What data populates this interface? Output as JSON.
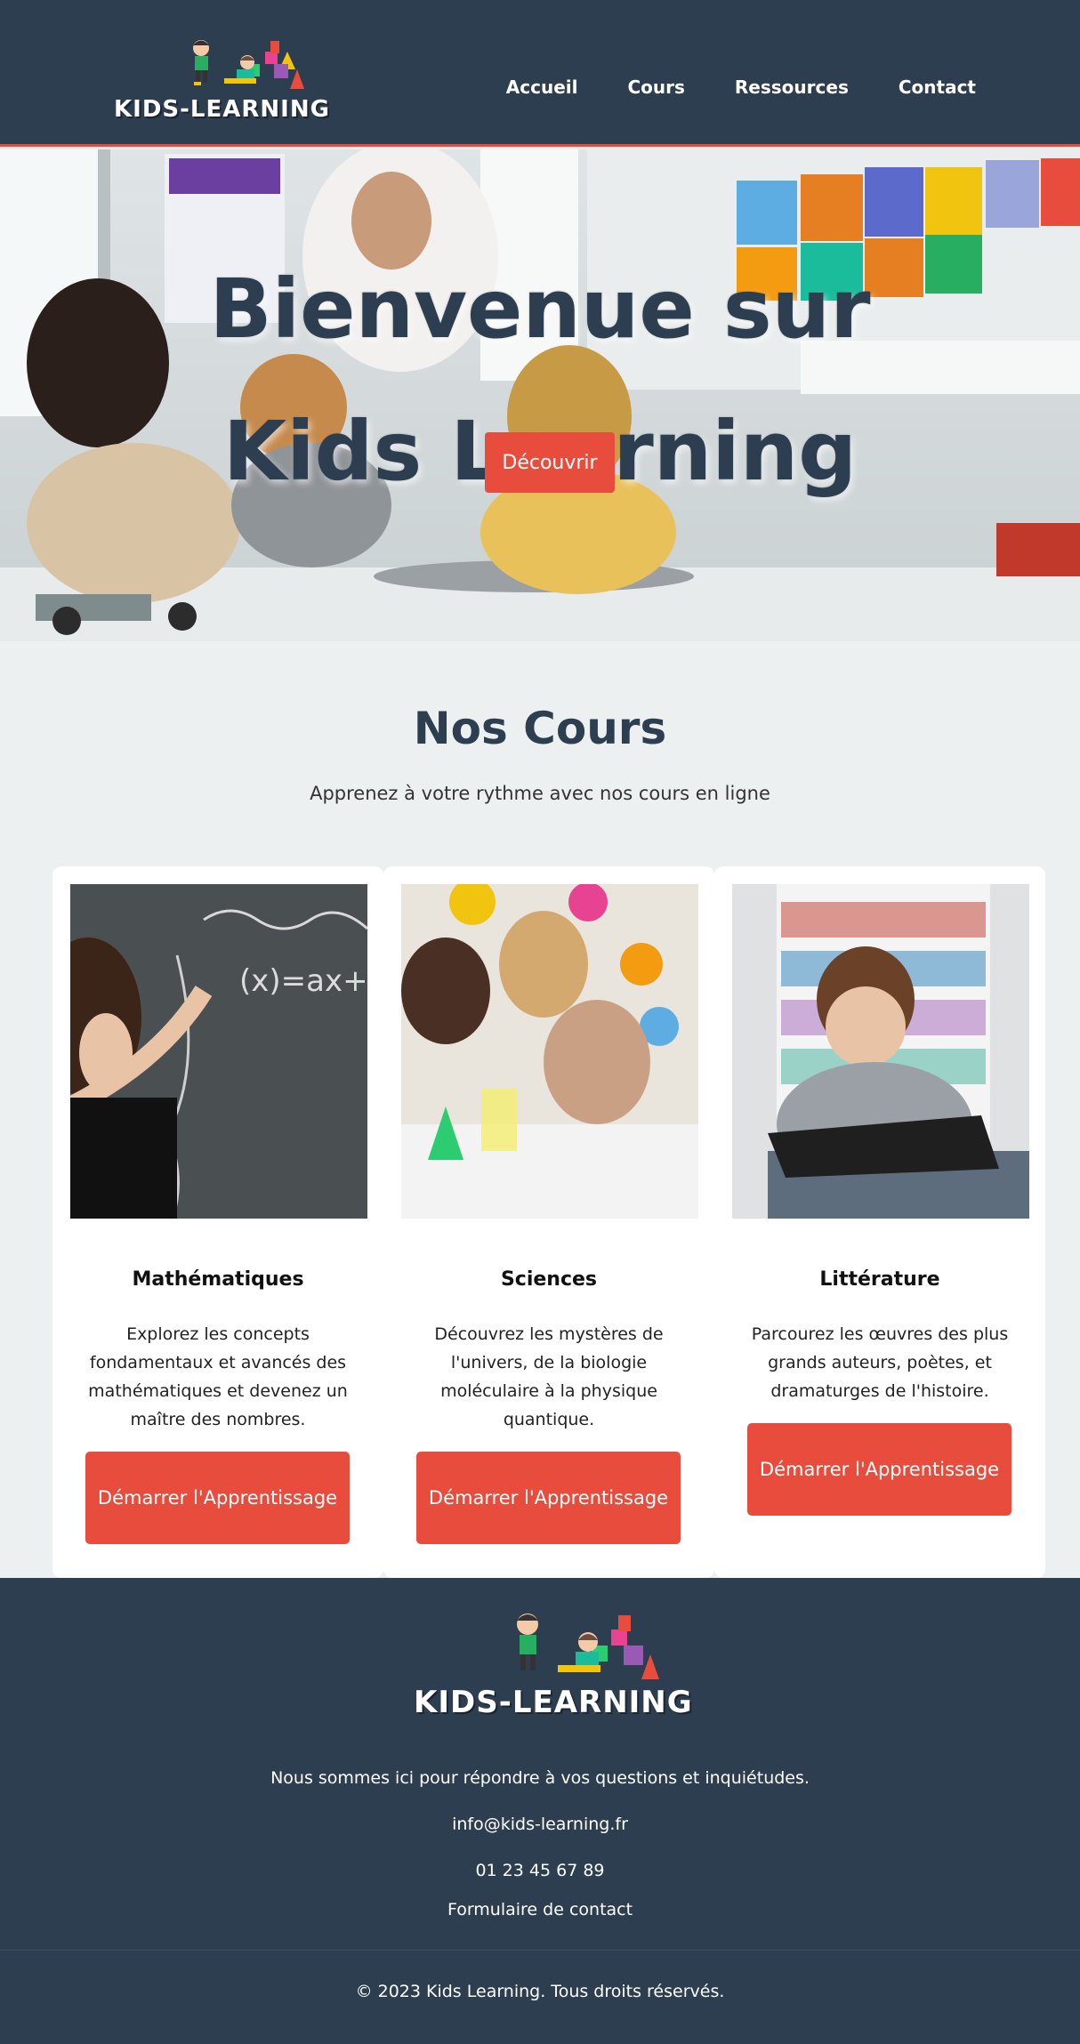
{
  "brand": {
    "logo_text": "KIDS-LEARNING"
  },
  "nav": {
    "items": [
      "Accueil",
      "Cours",
      "Ressources",
      "Contact"
    ]
  },
  "hero": {
    "title": "Bienvenue sur Kids Learning",
    "button": "Découvrir"
  },
  "courses": {
    "title": "Nos Cours",
    "subtitle": "Apprenez à votre rythme avec nos cours en ligne",
    "cards": [
      {
        "title": "Mathématiques",
        "description": "Explorez les concepts fondamentaux et avancés des mathématiques et devenez un maître des nombres.",
        "button": "Démarrer l'Apprentissage"
      },
      {
        "title": "Sciences",
        "description": "Découvrez les mystères de l'univers, de la biologie moléculaire à la physique quantique.",
        "button": "Démarrer l'Apprentissage"
      },
      {
        "title": "Littérature",
        "description": "Parcourez les œuvres des plus grands auteurs, poètes, et dramaturges de l'histoire.",
        "button": "Démarrer l'Apprentissage"
      }
    ]
  },
  "footer": {
    "tagline": "Nous sommes ici pour répondre à vos questions et inquiétudes.",
    "email": "info@kids-learning.fr",
    "phone": "01 23 45 67 89",
    "contact_link": "Formulaire de contact",
    "copyright": "© 2023 Kids Learning. Tous droits réservés."
  },
  "colors": {
    "navy": "#2c3e50",
    "accent": "#e74c3c",
    "background": "#ecf0f1"
  }
}
